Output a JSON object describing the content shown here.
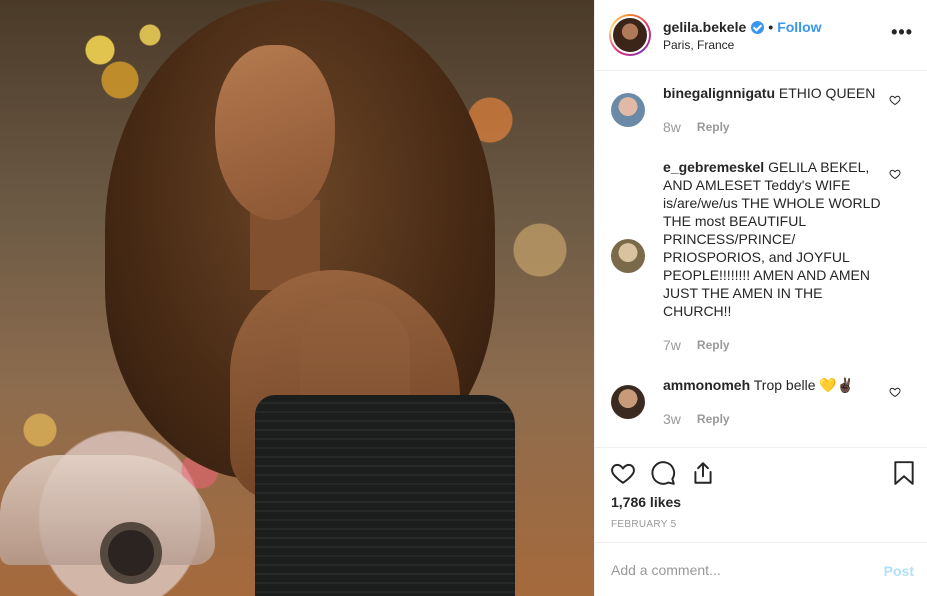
{
  "post": {
    "username": "gelila.bekele",
    "verified": true,
    "separator": "•",
    "follow_label": "Follow",
    "location": "Paris, France",
    "more_label": "•••",
    "image_alt": "Portrait photo"
  },
  "comments": [
    {
      "user": "binegalignnigatu",
      "text": "ETHIO QUEEN",
      "time": "8w",
      "reply_label": "Reply"
    },
    {
      "user": "e_gebremeskel",
      "text": "GELILA BEKEL, AND AMLESET Teddy's WIFE is/are/we/us THE WHOLE WORLD THE most BEAUTIFUL PRINCESS/PRINCE/ PRIOSPORIOS, and JOYFUL PEOPLE!!!!!!!! AMEN AND AMEN JUST THE AMEN IN THE CHURCH!!",
      "time": "7w",
      "reply_label": "Reply"
    },
    {
      "user": "ammonomeh",
      "text": "Trop belle 💛✌🏿",
      "time": "3w",
      "reply_label": "Reply"
    }
  ],
  "actions": {
    "icons": [
      "heart-icon",
      "comment-icon",
      "share-icon",
      "bookmark-icon"
    ],
    "likes": "1,786 likes",
    "date": "FEBRUARY 5"
  },
  "add_comment": {
    "placeholder": "Add a comment...",
    "post_label": "Post"
  },
  "colors": {
    "link_blue": "#3897f0",
    "post_disabled": "#b2dffc",
    "muted": "#999999",
    "text": "#262626"
  }
}
